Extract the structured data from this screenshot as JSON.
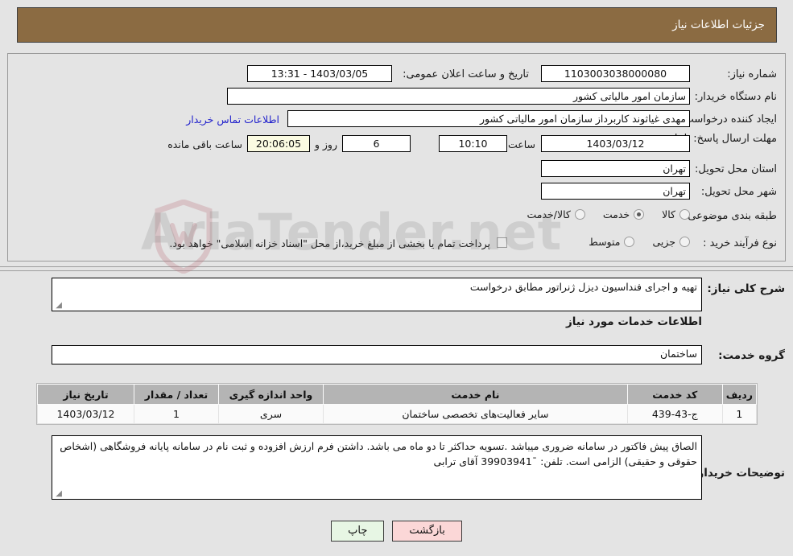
{
  "banner": {
    "title": "جزئیات اطلاعات نیاز"
  },
  "form": {
    "need_number_label": "شماره نیاز:",
    "need_number_value": "1103003038000080",
    "announce_label": "تاریخ و ساعت اعلان عمومی:",
    "announce_value": "1403/03/05 - 13:31",
    "buyer_org_label": "نام دستگاه خریدار:",
    "buyer_org_value": "سازمان امور مالیاتی کشور",
    "creator_label": "ایجاد کننده درخواست:",
    "creator_value": "مهدی غیاثوند کاربرداز سازمان امور مالیاتی کشور",
    "contact_link": "اطلاعات تماس خریدار",
    "deadline_label": "مهلت ارسال پاسخ: تا تاریخ:",
    "deadline_date": "1403/03/12",
    "hour_label": "ساعت",
    "deadline_time": "10:10",
    "days_value": "6",
    "days_label": "روز و",
    "remaining_time": "20:06:05",
    "remaining_label": "ساعت باقی مانده",
    "province_label": "استان محل تحویل:",
    "province_value": "تهران",
    "city_label": "شهر محل تحویل:",
    "city_value": "تهران",
    "category_label": "طبقه بندی موضوعی:",
    "category_options": [
      {
        "label": "کالا",
        "selected": false
      },
      {
        "label": "خدمت",
        "selected": true
      },
      {
        "label": "کالا/خدمت",
        "selected": false
      }
    ],
    "process_label": "نوع فرآیند خرید :",
    "process_options": [
      {
        "label": "جزیی",
        "selected": false
      },
      {
        "label": "متوسط",
        "selected": false
      }
    ],
    "treasury_checkbox_text": "پرداخت تمام یا بخشی از مبلغ خرید،از محل \"اسناد خزانه اسلامی\" خواهد بود."
  },
  "body": {
    "general_desc_label": "شرح کلی نیاز:",
    "general_desc_value": "تهیه و اجرای فنداسیون دیزل ژنراتور مطابق درخواست",
    "services_heading": "اطلاعات خدمات مورد نیاز",
    "service_group_label": "گروه خدمت:",
    "service_group_value": "ساختمان"
  },
  "table": {
    "columns": [
      "ردیف",
      "کد خدمت",
      "نام خدمت",
      "واحد اندازه گیری",
      "تعداد / مقدار",
      "تاریخ نیاز"
    ],
    "rows": [
      {
        "row_no": "1",
        "service_code": "ج-43-439",
        "service_name": "سایر فعالیت‌های تخصصی ساختمان",
        "unit": "سری",
        "quantity": "1",
        "need_date": "1403/03/12"
      }
    ]
  },
  "notes": {
    "label": "توضیحات خریدار:",
    "value": "الصاق پیش فاکتور در سامانه ضروری میباشد .تسویه حداکثر تا دو ماه می باشد.  داشتن فرم ارزش افزوده و ثبت نام در سامانه پایانه فروشگاهی (اشخاص حقوقی و حقیقی) الزامی است. تلفن: ¯39903941 آقای ترابی"
  },
  "buttons": {
    "print": "چاپ",
    "back": "بازگشت"
  },
  "watermark": {
    "text": "AriaTender.net"
  },
  "colors": {
    "banner_bg": "#8b6b42",
    "link": "#2222cc",
    "table_header_bg": "#b4b4b4",
    "print_btn_bg": "#e7f6e4",
    "back_btn_bg": "#fbd7d7",
    "highlight_field_bg": "#fbfbe2"
  }
}
